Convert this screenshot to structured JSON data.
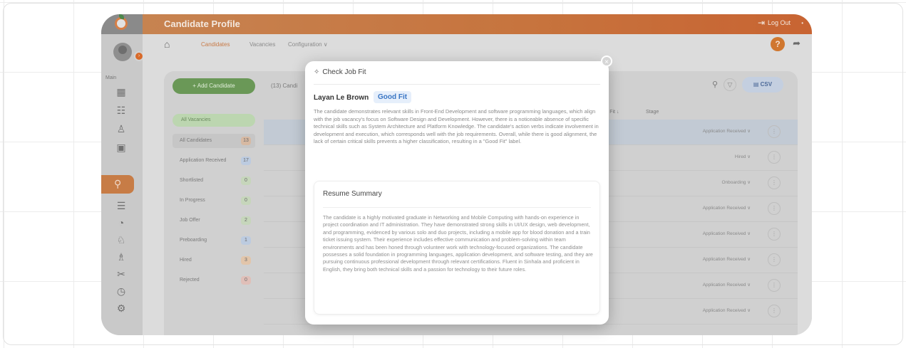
{
  "app": {
    "title": "Candidate Profile",
    "logout_label": "Log Out"
  },
  "nav": {
    "items": [
      "Candidates",
      "Vacancies",
      "Configuration ∨"
    ]
  },
  "toolbar": {
    "add_label": "+ Add Candidate",
    "count_label": "(13) Candi",
    "csv_label": "CSV",
    "filter_label": "All Vacancies"
  },
  "stages": [
    {
      "label": "All Candidates",
      "count": "13",
      "color": "#d7b9a2"
    },
    {
      "label": "Application Received",
      "count": "17",
      "color": "#bccbe0"
    },
    {
      "label": "Shortlisted",
      "count": "0",
      "color": "#c6d6bb"
    },
    {
      "label": "In Progress",
      "count": "0",
      "color": "#c6d6bb"
    },
    {
      "label": "Job Offer",
      "count": "2",
      "color": "#c6d6bb"
    },
    {
      "label": "Preboarding",
      "count": "1",
      "color": "#bccbe0"
    },
    {
      "label": "Hired",
      "count": "3",
      "color": "#e2c5aa"
    },
    {
      "label": "Rejected",
      "count": "0",
      "color": "#e0bfb8"
    }
  ],
  "table": {
    "headers": {
      "job_fit": "Job Fit ↓",
      "stage": "Stage"
    },
    "rows": [
      {
        "stage": "Application Received ∨"
      },
      {
        "stage": "Hired ∨"
      },
      {
        "stage": "Onboarding ∨"
      },
      {
        "stage": "Application Received ∨"
      },
      {
        "stage": "Application Received ∨"
      },
      {
        "stage": "Application Received ∨"
      },
      {
        "stage": "Application Received ∨"
      },
      {
        "stage": "Application Received ∨"
      }
    ]
  },
  "modal": {
    "title": "Check Job Fit",
    "candidate_name": "Layan Le Brown",
    "fit_label": "Good Fit",
    "fit_explanation": "The candidate demonstrates relevant skills in Front-End Development and software programming languages, which align with the job vacancy's focus on Software Design and Development. However, there is a noticeable absence of specific technical skills such as System Architecture and Platform Knowledge. The candidate's action verbs indicate involvement in development and execution, which corresponds well with the job requirements. Overall, while there is good alignment, the lack of certain critical skills prevents a higher classification, resulting in a \"Good Fit\" label.",
    "summary_title": "Resume Summary",
    "summary_text": "The candidate is a highly motivated graduate in Networking and Mobile Computing with hands-on experience in project coordination and IT administration. They have demonstrated strong skills in UI/UX design, web development, and programming, evidenced by various solo and duo projects, including a mobile app for blood donation and a train ticket issuing system. Their experience includes effective communication and problem-solving within team environments and has been honed through volunteer work with technology-focused organizations. The candidate possesses a solid foundation in programming languages, application development, and software testing, and they are pursuing continuous professional development through relevant certifications. Fluent in Sinhala and proficient in English, they bring both technical skills and a passion for technology to their future roles."
  }
}
